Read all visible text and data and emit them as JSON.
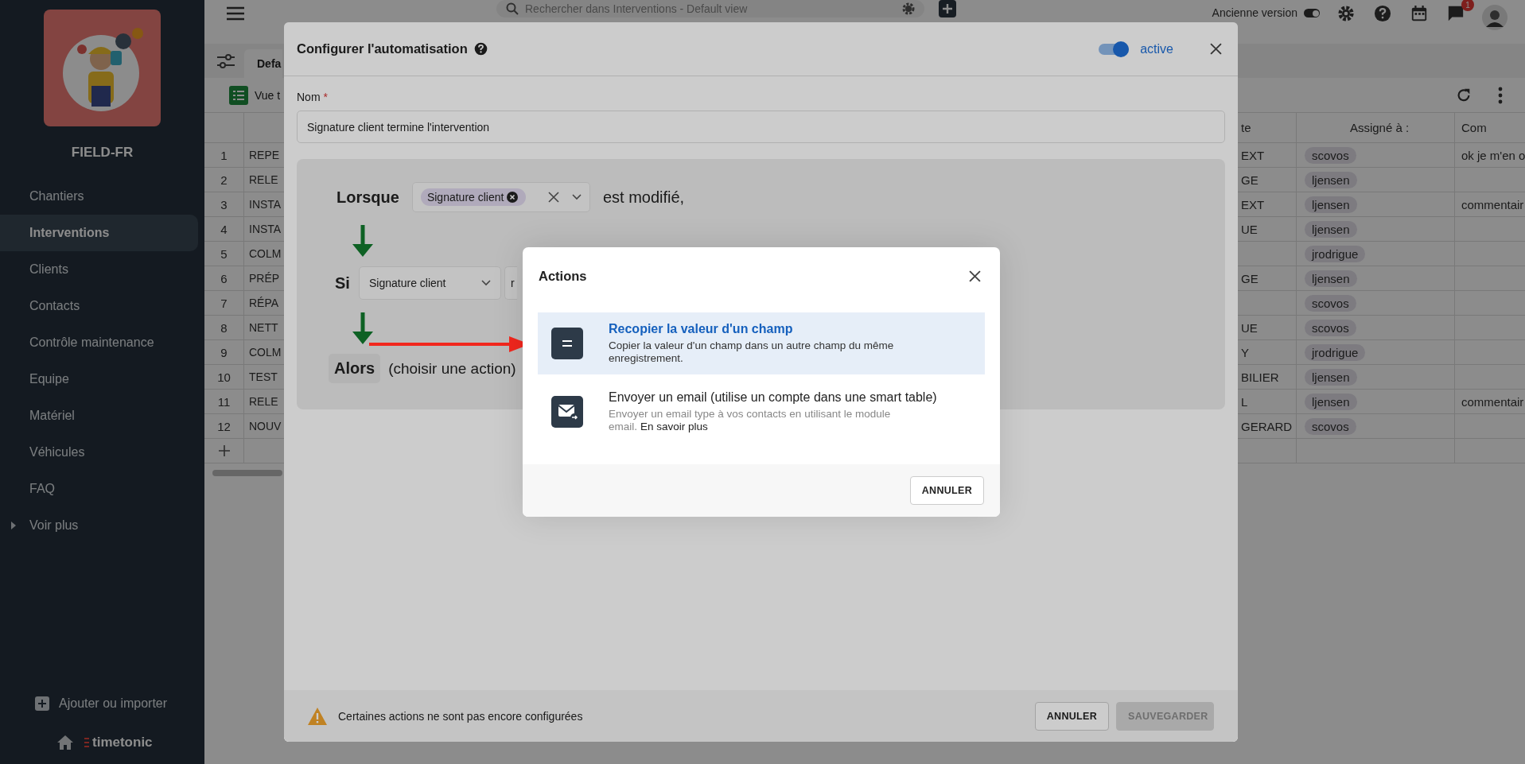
{
  "sidebar": {
    "brand": "FIELD-FR",
    "items": [
      {
        "label": "Chantiers",
        "selected": false
      },
      {
        "label": "Interventions",
        "selected": true
      },
      {
        "label": "Clients",
        "selected": false
      },
      {
        "label": "Contacts",
        "selected": false
      },
      {
        "label": "Contrôle maintenance",
        "selected": false
      },
      {
        "label": "Equipe",
        "selected": false
      },
      {
        "label": "Matériel",
        "selected": false
      },
      {
        "label": "Véhicules",
        "selected": false
      },
      {
        "label": "FAQ",
        "selected": false
      }
    ],
    "more": "Voir plus",
    "add": "Ajouter ou importer",
    "footer_logo": "timetonic"
  },
  "topbar": {
    "search_placeholder": "Rechercher dans Interventions - Default view",
    "legacy_label": "Ancienne version",
    "legacy_on": true,
    "notifications": "1"
  },
  "view_tab": "Defa",
  "view_name": "Vue t",
  "table": {
    "columns": [
      {
        "label": "te"
      },
      {
        "label": "Assigné à :"
      },
      {
        "label": "Com"
      }
    ],
    "rows": [
      {
        "number": "1",
        "column_2": "REPE",
        "column_3": "EXT",
        "assignee": "scovos",
        "comment": "ok je m'en o"
      },
      {
        "number": "2",
        "column_2": "RELE",
        "column_3": "GE",
        "assignee": "ljensen"
      },
      {
        "number": "3",
        "column_2": "INSTA",
        "column_3": "EXT",
        "assignee": "ljensen",
        "comment": "commentair"
      },
      {
        "number": "4",
        "column_2": "INSTA",
        "column_3": "UE",
        "assignee": "ljensen"
      },
      {
        "number": "5",
        "column_2": "COLM",
        "assignee": "jrodrigue"
      },
      {
        "number": "6",
        "column_2": "PRÉP",
        "column_3": "GE",
        "assignee": "ljensen"
      },
      {
        "number": "7",
        "column_2": "RÉPA",
        "assignee": "scovos"
      },
      {
        "number": "8",
        "column_2": "NETT",
        "column_3": "UE",
        "assignee": "scovos"
      },
      {
        "number": "9",
        "column_2": "COLM",
        "column_3": "Y",
        "assignee": "jrodrigue"
      },
      {
        "number": "10",
        "column_2": "TEST",
        "column_3": "BILIER",
        "assignee": "ljensen"
      },
      {
        "number": "11",
        "column_2": "RELE",
        "column_3": "L",
        "assignee": "ljensen",
        "comment": "commentair"
      },
      {
        "number": "12",
        "column_2": "NOUV",
        "column_3": "GERARD",
        "assignee": "scovos"
      }
    ]
  },
  "dialog": {
    "title": "Configurer l'automatisation",
    "active": true,
    "active_label": "active",
    "name_label": "Nom",
    "required_mark": "*",
    "name_value": "Signature client termine l'intervention",
    "trigger": {
      "label": "Lorsque",
      "chip": "Signature client",
      "suffix": "est modifié,"
    },
    "condition": {
      "label": "Si",
      "field": "Signature client",
      "operator": "r"
    },
    "then": {
      "label": "Alors",
      "placeholder": "(choisir une action)"
    },
    "warning": "Certaines actions ne sont pas encore configurées",
    "cancel": "ANNULER",
    "save": "SAUVEGARDER",
    "save_disabled": true
  },
  "actions_dialog": {
    "title": "Actions",
    "items": [
      {
        "kind": "copy",
        "title": "Recopier la valeur d'un champ",
        "description": "Copier la valeur d'un champ dans un autre champ du même enregistrement.",
        "selected": true
      },
      {
        "kind": "email",
        "title": "Envoyer un email (utilise un compte dans une smart table)",
        "description": "Envoyer un email type à vos contacts en utilisant le module email.",
        "link": "En savoir plus",
        "selected": false
      }
    ],
    "cancel": "ANNULER"
  }
}
